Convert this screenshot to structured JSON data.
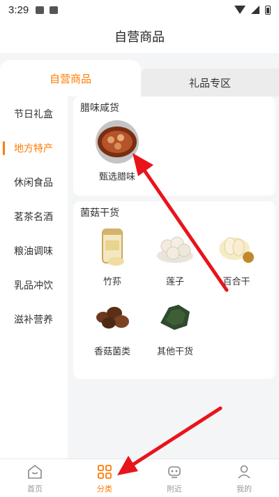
{
  "status_bar": {
    "time": "3:29"
  },
  "header": {
    "title": "自营商品"
  },
  "tabs": [
    {
      "label": "自营商品",
      "active": true
    },
    {
      "label": "礼品专区",
      "active": false
    }
  ],
  "sidebar": {
    "items": [
      {
        "label": "节日礼盒"
      },
      {
        "label": "地方特产",
        "active": true
      },
      {
        "label": "休闲食品"
      },
      {
        "label": "茗茶名酒"
      },
      {
        "label": "粮油调味"
      },
      {
        "label": "乳品冲饮"
      },
      {
        "label": "滋补营养"
      }
    ]
  },
  "sections": [
    {
      "title": "腊味咸货",
      "products": [
        {
          "label": "甄选腊味",
          "icon": "cured-meat-icon"
        }
      ]
    },
    {
      "title": "菌菇干货",
      "products": [
        {
          "label": "竹荪",
          "icon": "bamboo-fungus-icon"
        },
        {
          "label": "莲子",
          "icon": "lotus-seed-icon"
        },
        {
          "label": "百合干",
          "icon": "dried-lily-icon"
        },
        {
          "label": "香菇菌类",
          "icon": "mushroom-icon"
        },
        {
          "label": "其他干货",
          "icon": "seaweed-icon"
        }
      ]
    }
  ],
  "bottom_nav": {
    "items": [
      {
        "label": "首页",
        "icon": "home-icon"
      },
      {
        "label": "分类",
        "icon": "category-icon",
        "active": true
      },
      {
        "label": "附近",
        "icon": "nearby-icon"
      },
      {
        "label": "我的",
        "icon": "profile-icon"
      }
    ]
  },
  "colors": {
    "accent": "#ff7a00",
    "annotation": "#e8141b",
    "background": "#f4f5f7"
  }
}
